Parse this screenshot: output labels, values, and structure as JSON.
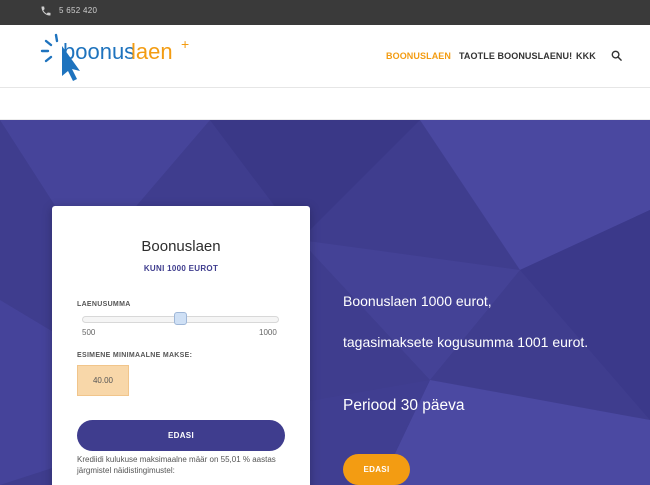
{
  "topbar": {
    "phone": "5 652 420"
  },
  "logo": {
    "text_dark": "boonus",
    "text_orange": "laen",
    "plus": "+"
  },
  "nav": {
    "items": [
      {
        "label": "BOONUSLAEN",
        "active": true
      },
      {
        "label": "TAOTLE BOONUSLAENU!",
        "active": false
      },
      {
        "label": "KKK",
        "active": false
      }
    ]
  },
  "card": {
    "title": "Boonuslaen",
    "subtitle": "KUNI 1000 EUROT",
    "amount_label": "LAENUSUMMA",
    "slider": {
      "min": "500",
      "max": "1000",
      "value_fraction": 0.5
    },
    "payment_label": "ESIMENE MINIMAALNE MAKSE:",
    "payment_value": "40.00",
    "button": "EDASI",
    "footnote": "Krediidi kulukuse maksimaalne määr on 55,01 % aastas järgmistel näidistingimustel:"
  },
  "hero": {
    "line1": "Boonuslaen 1000 eurot,",
    "line2": "tagasimaksete kogusumma 1001 eurot.",
    "line3": "Periood 30 päeva",
    "button": "EDASI"
  },
  "colors": {
    "primary": "#3f3d8e",
    "accent": "#f39c12",
    "logo_blue": "#1e73be"
  }
}
